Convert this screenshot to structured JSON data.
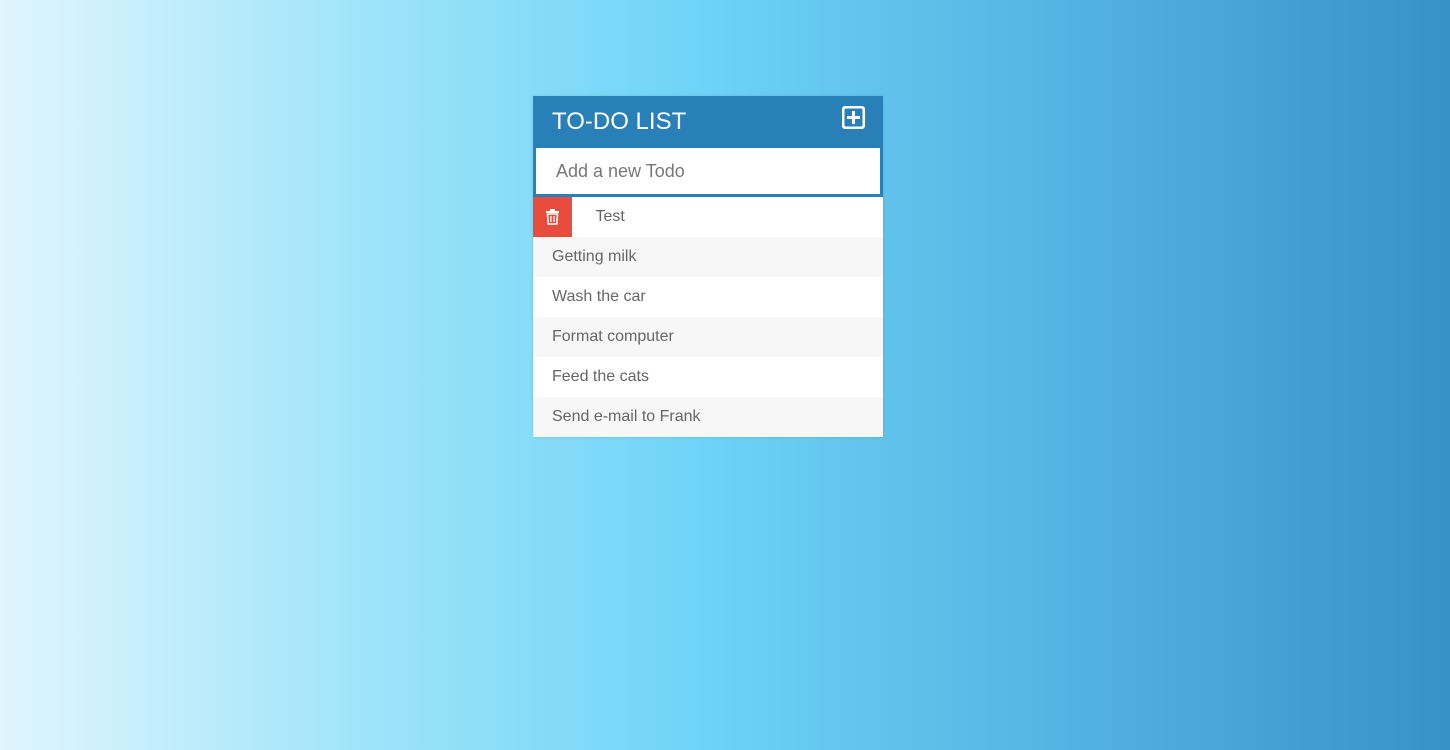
{
  "app": {
    "title": "TO-DO LIST"
  },
  "input": {
    "placeholder": "Add a new Todo",
    "value": ""
  },
  "todos": [
    {
      "text": "Test",
      "hovered": true
    },
    {
      "text": "Getting milk"
    },
    {
      "text": "Wash the car"
    },
    {
      "text": "Format computer"
    },
    {
      "text": "Feed the cats"
    },
    {
      "text": "Send e-mail to Frank"
    }
  ],
  "icons": {
    "add": "plus-square-icon",
    "delete": "trash-icon"
  },
  "colors": {
    "header": "#2980b9",
    "delete": "#e74c3c",
    "text": "#666666",
    "row_alt": "#f7f7f7"
  }
}
